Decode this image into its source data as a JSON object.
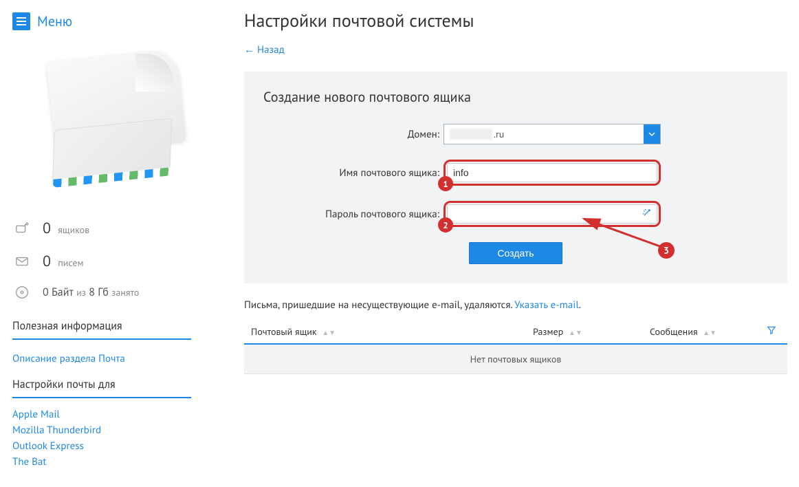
{
  "sidebar": {
    "menu_label": "Меню",
    "stats": {
      "mailboxes_value": "0",
      "mailboxes_unit": "ящиков",
      "letters_value": "0",
      "letters_unit": "писем",
      "storage_used_value": "0 Байт",
      "storage_of": "из",
      "storage_total": "8 Гб",
      "storage_suffix": "занято"
    },
    "info_heading": "Полезная информация",
    "info_link": "Описание раздела Почта",
    "clients_heading": "Настройки почты для",
    "clients": [
      "Apple Mail",
      "Mozilla Thunderbird",
      "Outlook Express",
      "The Bat"
    ]
  },
  "main": {
    "page_title": "Настройки почтовой системы",
    "back_label": "← Назад",
    "panel_title": "Создание нового почтового ящика",
    "domain_label": "Домен:",
    "domain_suffix": ".ru",
    "mailbox_label": "Имя почтового ящика:",
    "mailbox_value": "info",
    "password_label": "Пароль почтового ящика:",
    "password_value": "",
    "submit_label": "Создать",
    "badge1": "1",
    "badge2": "2",
    "badge3": "3",
    "note_prefix": "Письма, пришедшие на несуществующие e-mail, удаляются. ",
    "note_link": "Указать e-mail",
    "note_suffix": ".",
    "table": {
      "col_mailbox": "Почтовый ящик",
      "col_size": "Размер",
      "col_messages": "Сообщения",
      "empty": "Нет почтовых ящиков"
    }
  }
}
